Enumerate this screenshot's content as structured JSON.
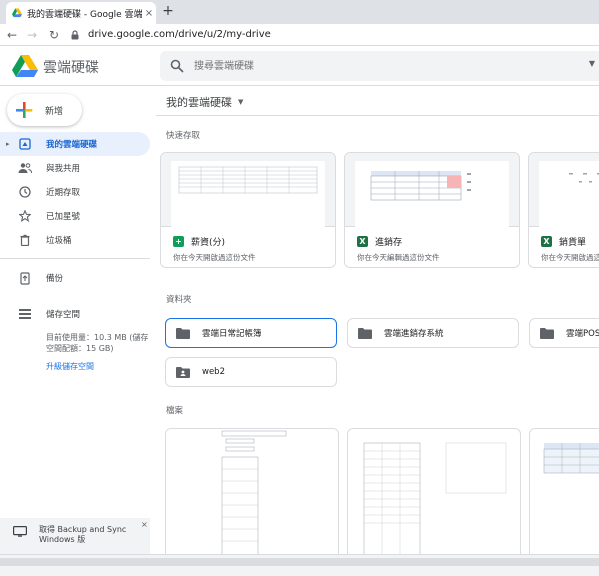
{
  "browser": {
    "tab_title": "我的雲端硬碟 - Google 雲端硬碟",
    "tab_close": "×",
    "new_tab": "+",
    "back": "←",
    "forward": "→",
    "reload": "↻",
    "url": "drive.google.com/drive/u/2/my-drive"
  },
  "header": {
    "app_name": "雲端硬碟",
    "search_placeholder": "搜尋雲端硬碟",
    "search_caret": "▼"
  },
  "sidebar": {
    "new_label": "新增",
    "items": [
      {
        "label": "我的雲端硬碟",
        "icon": "my-drive-icon",
        "active": true
      },
      {
        "label": "與我共用",
        "icon": "shared-people-icon"
      },
      {
        "label": "近期存取",
        "icon": "clock-icon"
      },
      {
        "label": "已加星號",
        "icon": "star-icon"
      },
      {
        "label": "垃圾桶",
        "icon": "trash-icon"
      },
      {
        "label": "備份",
        "icon": "backup-icon"
      },
      {
        "label": "儲存空間",
        "icon": "storage-icon"
      }
    ],
    "expand_arrow": "▸",
    "quota_text": "目前使用量：10.3 MB (儲存空間配額：15 GB)",
    "upgrade_link": "升級儲存空間",
    "backup_promo": {
      "line1": "取得 Backup and Sync",
      "line2": "Windows 版",
      "close": "×"
    }
  },
  "main": {
    "breadcrumb": "我的雲端硬碟",
    "breadcrumb_caret": "▼",
    "quick_access_title": "快速存取",
    "quick_access": [
      {
        "name": "薪資(分)",
        "type": "sheets",
        "subtitle": "你在今天開啟過這份文件"
      },
      {
        "name": "進銷存",
        "type": "excel",
        "subtitle": "你在今天編輯過這份文件"
      },
      {
        "name": "銷貨單",
        "type": "excel",
        "subtitle": "你在今天開啟過這份文件"
      }
    ],
    "folders_title": "資料夾",
    "folders": [
      {
        "name": "雲端日常記帳簿",
        "selected": true,
        "shared": false
      },
      {
        "name": "雲端進銷存系統",
        "selected": false,
        "shared": false
      },
      {
        "name": "雲端POS系統",
        "selected": false,
        "shared": false
      },
      {
        "name": "web2",
        "selected": false,
        "shared": true
      }
    ],
    "files_title": "檔案"
  },
  "colors": {
    "accent": "#1a73e8",
    "sheets_green": "#0f9d58",
    "excel_green": "#1e7145",
    "active_bg": "#e8f0fe"
  }
}
